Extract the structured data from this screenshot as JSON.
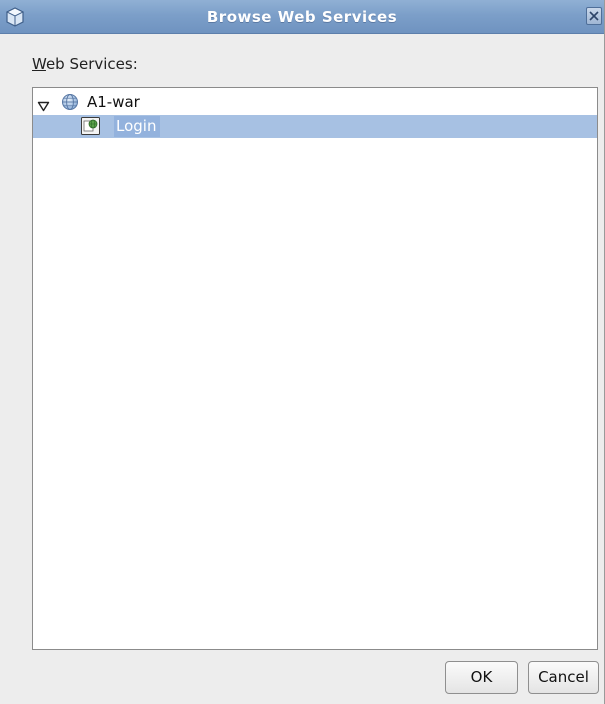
{
  "window": {
    "title": "Browse Web Services",
    "app_icon": "netbeans-cube-icon",
    "close_icon": "close-icon"
  },
  "label": {
    "mnemonic": "W",
    "rest": "eb Services:"
  },
  "tree": {
    "root": {
      "label": "A1-war",
      "expanded": true,
      "icon": "globe-icon"
    },
    "children": [
      {
        "label": "Login",
        "selected": true,
        "icon": "web-service-icon"
      }
    ]
  },
  "buttons": {
    "ok": "OK",
    "cancel": "Cancel"
  },
  "colors": {
    "titlebar": "#7c9fc9",
    "selection": "#a7c1e3",
    "background": "#ededed"
  }
}
